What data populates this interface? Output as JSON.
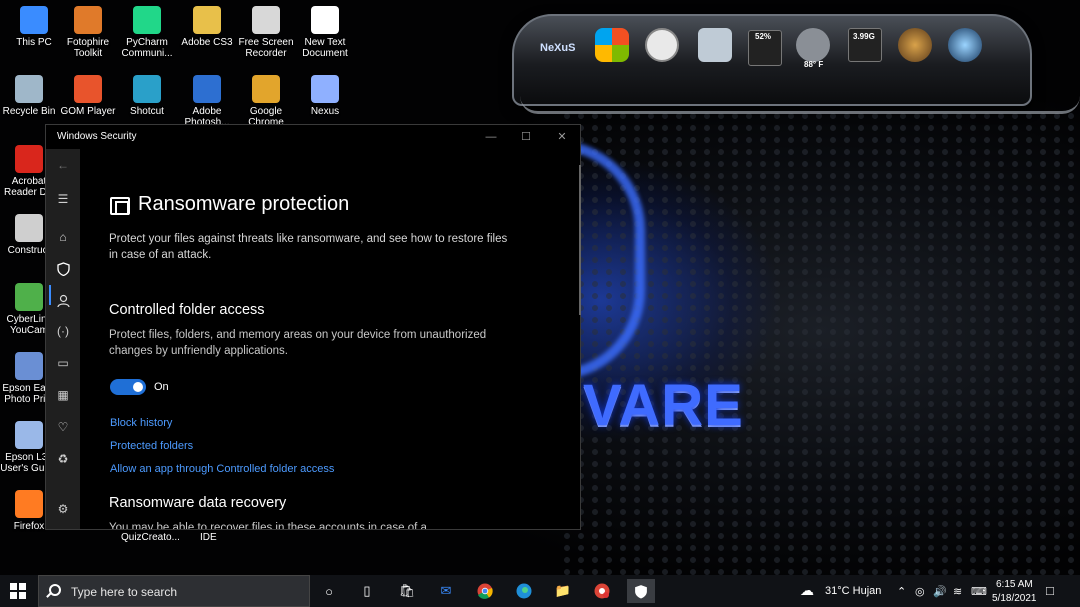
{
  "desktop": {
    "icons": [
      {
        "label": "This PC",
        "icon": "computer-icon",
        "color": "#3a8cff"
      },
      {
        "label": "Fotophire Toolkit",
        "icon": "fotophire-icon",
        "color": "#e07a2a"
      },
      {
        "label": "PyCharm Communi...",
        "icon": "pycharm-icon",
        "color": "#21d789"
      },
      {
        "label": "Adobe CS3",
        "icon": "folder-icon",
        "color": "#e8c04a"
      },
      {
        "label": "Free Screen Recorder",
        "icon": "recorder-icon",
        "color": "#d8d8d8"
      },
      {
        "label": "New Text Document",
        "icon": "text-document-icon",
        "color": "#ffffff"
      },
      {
        "label": "Recycle Bin",
        "icon": "recycle-bin-icon",
        "color": "#9fb7c9"
      },
      {
        "label": "GOM Player",
        "icon": "gom-player-icon",
        "color": "#e8542c"
      },
      {
        "label": "Shotcut",
        "icon": "shotcut-icon",
        "color": "#2aa0c9"
      },
      {
        "label": "Adobe Photosh...",
        "icon": "photoshop-icon",
        "color": "#2d6fd1"
      },
      {
        "label": "Google Chrome",
        "icon": "chrome-icon",
        "color": "#e2a52c"
      },
      {
        "label": "Nexus",
        "icon": "nexus-icon",
        "color": "#8fb0ff"
      },
      {
        "label": "Acrobat Reader DC",
        "icon": "acrobat-icon",
        "color": "#d9261c"
      },
      {
        "label": "Construct",
        "icon": "construct-icon",
        "color": "#cfcfcf"
      },
      {
        "label": "CyberLink YouCam",
        "icon": "youcam-icon",
        "color": "#4fb04a"
      },
      {
        "label": "Epson Easy Photo Print",
        "icon": "epson-photo-icon",
        "color": "#6a8fd4"
      },
      {
        "label": "Epson L31 User's Guide",
        "icon": "epson-guide-icon",
        "color": "#9ab8e8"
      },
      {
        "label": "Firefox",
        "icon": "firefox-icon",
        "color": "#ff7b22"
      }
    ],
    "brand_text": "VARE",
    "dock": {
      "logo": "NeXuS",
      "cpu": "52%",
      "temp": "88° F",
      "memory": "3.99G"
    },
    "below_window_labels": [
      "QuizCreato...",
      "IDE"
    ]
  },
  "window": {
    "title": "Windows Security",
    "controls": {
      "minimize": "—",
      "maximize": "☐",
      "close": "✕"
    },
    "nav_icons": [
      "back-arrow-icon",
      "hamburger-menu-icon",
      "home-icon",
      "shield-icon",
      "account-icon",
      "firewall-icon",
      "app-browser-icon",
      "device-security-icon",
      "health-heart-icon",
      "family-icon",
      "settings-gear-icon"
    ],
    "page_title": "Ransomware protection",
    "page_desc": "Protect your files against threats like ransomware, and see how to restore files in case of an attack.",
    "cfa": {
      "heading": "Controlled folder access",
      "desc": "Protect files, folders, and memory areas on your device from unauthorized changes by unfriendly applications.",
      "toggle_label": "On",
      "toggle_on": true,
      "links": [
        "Block history",
        "Protected folders",
        "Allow an app through Controlled folder access"
      ]
    },
    "recovery": {
      "heading": "Ransomware data recovery",
      "desc": "You may be able to recover files in these accounts in case of a ransomware attack."
    }
  },
  "taskbar": {
    "search_placeholder": "Type here to search",
    "apps": [
      "cortana-icon",
      "task-view-icon",
      "store-icon",
      "mail-icon",
      "chrome-icon",
      "edge-icon",
      "file-explorer-icon",
      "chrome-profile-icon",
      "windows-security-icon"
    ],
    "weather": "31°C  Hujan",
    "time": "6:15 AM",
    "date": "5/18/2021"
  },
  "colors": {
    "accent": "#1f6fd6",
    "link": "#4d9bff",
    "brand": "#3f6bff"
  }
}
